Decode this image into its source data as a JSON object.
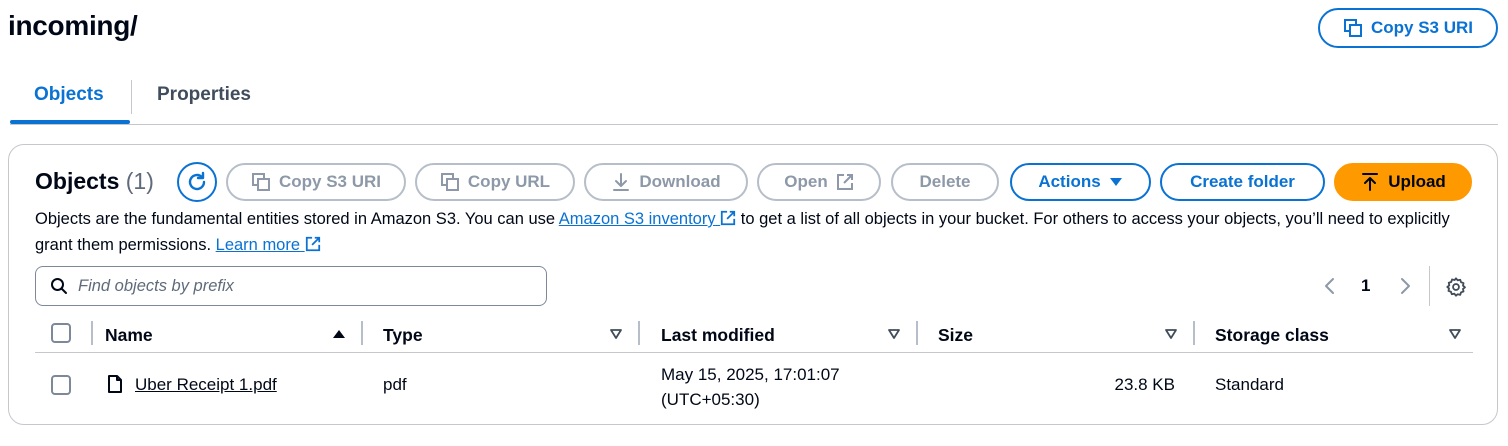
{
  "page": {
    "title": "incoming/",
    "copy_s3_uri_label": "Copy S3 URI"
  },
  "tabs": [
    {
      "label": "Objects",
      "active": true
    },
    {
      "label": "Properties",
      "active": false
    }
  ],
  "objects_panel": {
    "title": "Objects",
    "count": "(1)",
    "toolbar": {
      "copy_s3_uri": "Copy S3 URI",
      "copy_url": "Copy URL",
      "download": "Download",
      "open": "Open",
      "delete": "Delete",
      "actions": "Actions",
      "create_folder": "Create folder",
      "upload": "Upload"
    },
    "description": {
      "part1": "Objects are the fundamental entities stored in Amazon S3. You can use ",
      "inventory_link": "Amazon S3 inventory",
      "part2": " to get a list of all objects in your bucket. For others to access your objects, you’ll need to explicitly grant them permissions. ",
      "learn_more_link": "Learn more"
    },
    "search": {
      "placeholder": "Find objects by prefix",
      "value": ""
    },
    "pagination": {
      "current_page": "1"
    },
    "columns": [
      "Name",
      "Type",
      "Last modified",
      "Size",
      "Storage class"
    ],
    "rows": [
      {
        "name": "Uber Receipt 1.pdf",
        "type": "pdf",
        "last_modified_line1": "May 15, 2025, 17:01:07",
        "last_modified_line2": "(UTC+05:30)",
        "size": "23.8 KB",
        "storage_class": "Standard"
      }
    ]
  },
  "colors": {
    "accent": "#0972d3",
    "upload": "#ff9900",
    "disabled_border": "#b6bec9",
    "text": "#000716"
  },
  "icons": [
    "copy-icon",
    "refresh-icon",
    "download-icon",
    "external-link-icon",
    "caret-down-icon",
    "upload-icon",
    "search-icon",
    "chevron-left-icon",
    "chevron-right-icon",
    "settings-icon",
    "sort-ascending-icon",
    "sort-descending-icon",
    "file-icon"
  ]
}
